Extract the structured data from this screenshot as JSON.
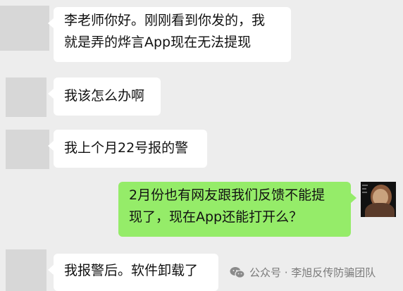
{
  "messages": [
    {
      "side": "left",
      "text": "李老师你好。刚刚看到你发的，我\n就是弄的烨言App现在无法提现"
    },
    {
      "side": "left",
      "text": "我该怎么办啊"
    },
    {
      "side": "left",
      "text": "我上个月22号报的警"
    },
    {
      "side": "right",
      "text": "2月份也有网友跟我们反馈不能提\n现了，现在App还能打开么？"
    },
    {
      "side": "left",
      "text": "我报警后。软件卸载了"
    }
  ],
  "watermark": {
    "text": "公众号 · 李旭反传防骗团队",
    "icon": "wechat-icon"
  },
  "colors": {
    "background": "#ededed",
    "bubble_in": "#ffffff",
    "bubble_out": "#95ec69",
    "avatar_placeholder": "#d7d7d7"
  }
}
